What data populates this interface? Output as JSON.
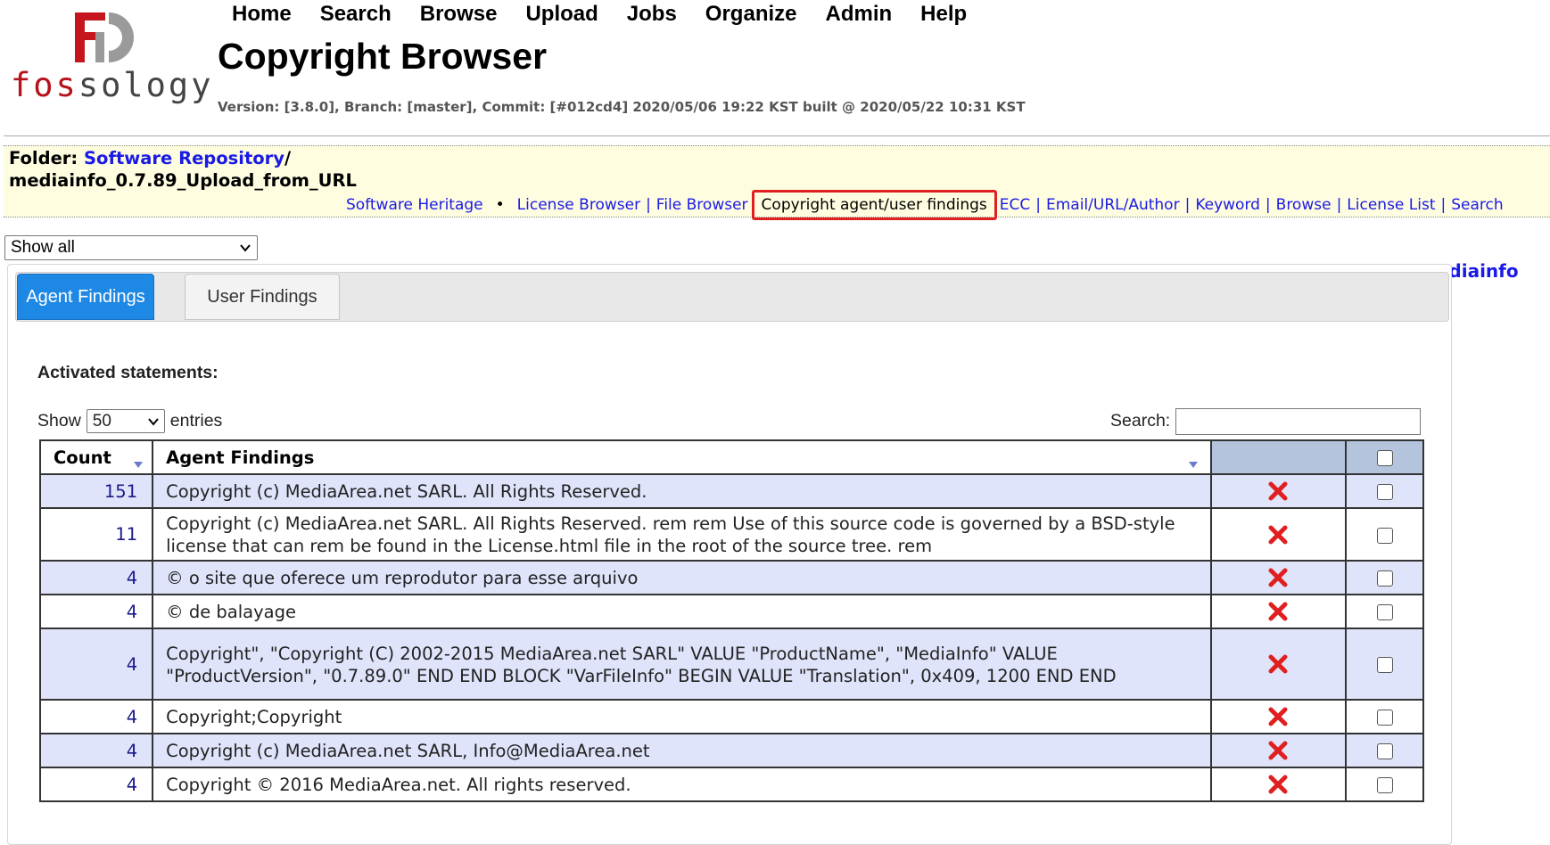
{
  "logo": {
    "text_red": "fos",
    "text_gray": "sology"
  },
  "nav": [
    "Home",
    "Search",
    "Browse",
    "Upload",
    "Jobs",
    "Organize",
    "Admin",
    "Help"
  ],
  "page_title": "Copyright Browser",
  "version_info": "Version: [3.8.0], Branch: [master], Commit: [#012cd4] 2020/05/06 19:22 KST built @ 2020/05/22 10:31 KST",
  "folder": {
    "label": "Folder",
    "repository": "Software Repository",
    "upload_name": "mediainfo_0.7.89_Upload_from_URL",
    "links": [
      "Software Heritage",
      "License Browser",
      "File Browser",
      "Copyright agent/user findings",
      "ECC",
      "Email/URL/Author",
      "Keyword",
      "Browse",
      "License List",
      "Search"
    ],
    "active_link": "Copyright agent/user findings"
  },
  "filter_select": {
    "value": "Show all"
  },
  "tabs": {
    "agent": "Agent Findings",
    "user": "User Findings"
  },
  "activated_label": "Activated statements:",
  "entries": {
    "show_label": "Show",
    "value": "50",
    "entries_label": "entries"
  },
  "search": {
    "label": "Search:",
    "value": ""
  },
  "table": {
    "headers": {
      "count": "Count",
      "findings": "Agent Findings"
    },
    "rows": [
      {
        "count": "151",
        "text": "Copyright (c) MediaArea.net SARL. All Rights Reserved."
      },
      {
        "count": "11",
        "text": "Copyright (c) MediaArea.net SARL. All Rights Reserved. rem rem Use of this source code is governed by a BSD-style license that can rem be found in the License.html file in the root of the source tree. rem"
      },
      {
        "count": "4",
        "text": "© o site que oferece um reprodutor para esse arquivo"
      },
      {
        "count": "4",
        "text": "© de balayage"
      },
      {
        "count": "4",
        "text": "Copyright\", \"Copyright (C) 2002-2015 MediaArea.net SARL\" VALUE \"ProductName\", \"MediaInfo\" VALUE \"ProductVersion\", \"0.7.89.0\" END END BLOCK \"VarFileInfo\" BEGIN VALUE \"Translation\", 0x409, 1200 END END"
      },
      {
        "count": "4",
        "text": "Copyright;Copyright"
      },
      {
        "count": "4",
        "text": "Copyright (c) MediaArea.net SARL, Info@MediaArea.net"
      },
      {
        "count": "4",
        "text": "Copyright © 2016 MediaArea.net. All rights reserved."
      }
    ]
  },
  "side_link": "mediainfo",
  "colors": {
    "brand_red": "#b5121b",
    "link_blue": "#1a1ae6",
    "tab_active": "#1e88e5",
    "row_alt": "#e0e4fb",
    "delete_red": "#e02020"
  }
}
